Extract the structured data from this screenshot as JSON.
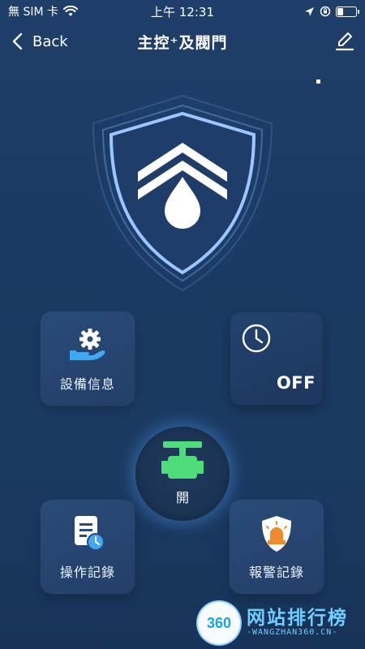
{
  "status_bar": {
    "carrier": "無 SIM 卡",
    "time": "上午 12:31",
    "battery_level": 0.35
  },
  "nav": {
    "back_label": "Back",
    "title": "主控⁺及閥門"
  },
  "tiles": {
    "device_info": {
      "label": "設備信息",
      "icon": "gear-hand-icon"
    },
    "timer": {
      "state": "OFF",
      "icon": "clock-icon"
    },
    "operation_log": {
      "label": "操作記錄",
      "icon": "document-clock-icon"
    },
    "alarm_log": {
      "label": "報警記錄",
      "icon": "siren-shield-icon"
    }
  },
  "valve": {
    "label": "開",
    "icon": "valve-icon",
    "color": "#4fdc7a"
  },
  "colors": {
    "background": "#1c3b64",
    "tile": "#274673",
    "accent_blue": "#3fa9f5",
    "alarm_orange": "#f08a2a"
  },
  "watermark": {
    "logo_text": "360",
    "title": "网站排行榜",
    "subtitle": "-WANGZHAN360.CN-"
  }
}
